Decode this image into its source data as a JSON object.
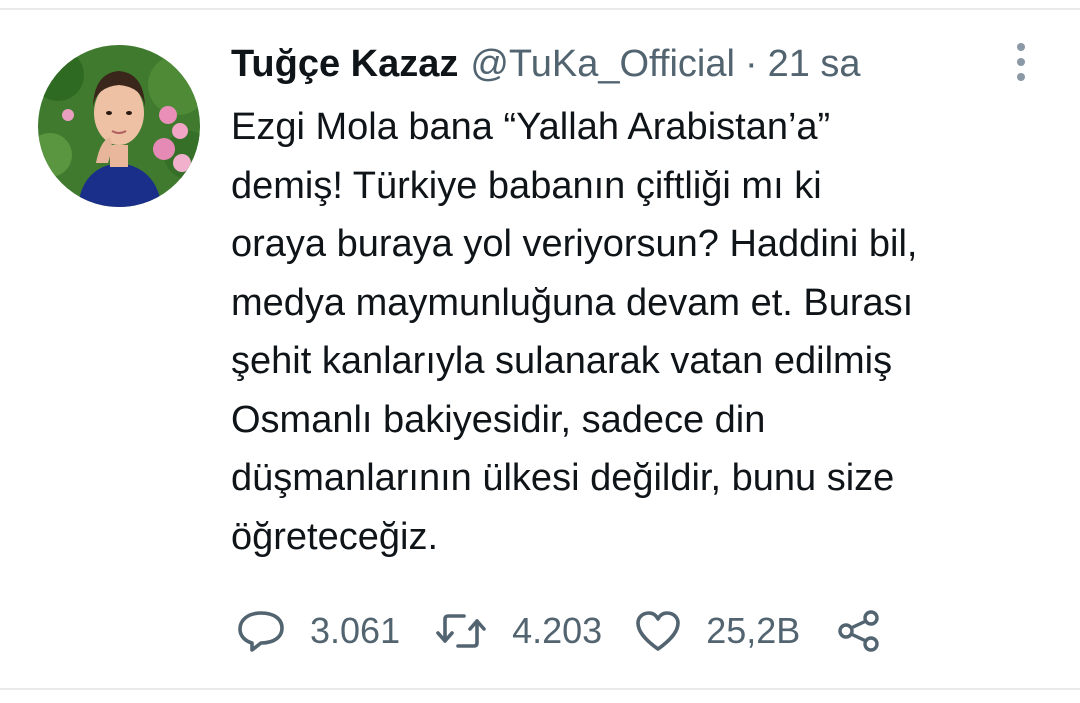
{
  "tweet": {
    "author": {
      "display_name": "Tuğçe Kazaz",
      "handle": "@TuKa_Official",
      "separator": "·",
      "time": "21 sa"
    },
    "text_lines": [
      "Ezgi Mola bana “Yallah Arabistan’a”",
      "demiş! Türkiye babanın çiftliği mı ki",
      "oraya buraya yol veriyorsun? Haddini bil,",
      "medya maymunluğuna devam et. Burası",
      "şehit kanlarıyla sulanarak vatan edilmiş",
      "Osmanlı bakiyesidir, sadece din",
      "düşmanlarının ülkesi değildir, bunu size",
      "öğreteceğiz."
    ],
    "actions": {
      "reply_count": "3.061",
      "retweet_count": "4.203",
      "like_count": "25,2B"
    }
  },
  "icons": {
    "avatar": "avatar",
    "more": "more-vertical-icon",
    "reply": "reply-icon",
    "retweet": "retweet-icon",
    "like": "heart-icon",
    "share": "share-icon"
  },
  "colors": {
    "text": "#0f1419",
    "secondary": "#536471",
    "divider": "#e7e9eb"
  }
}
